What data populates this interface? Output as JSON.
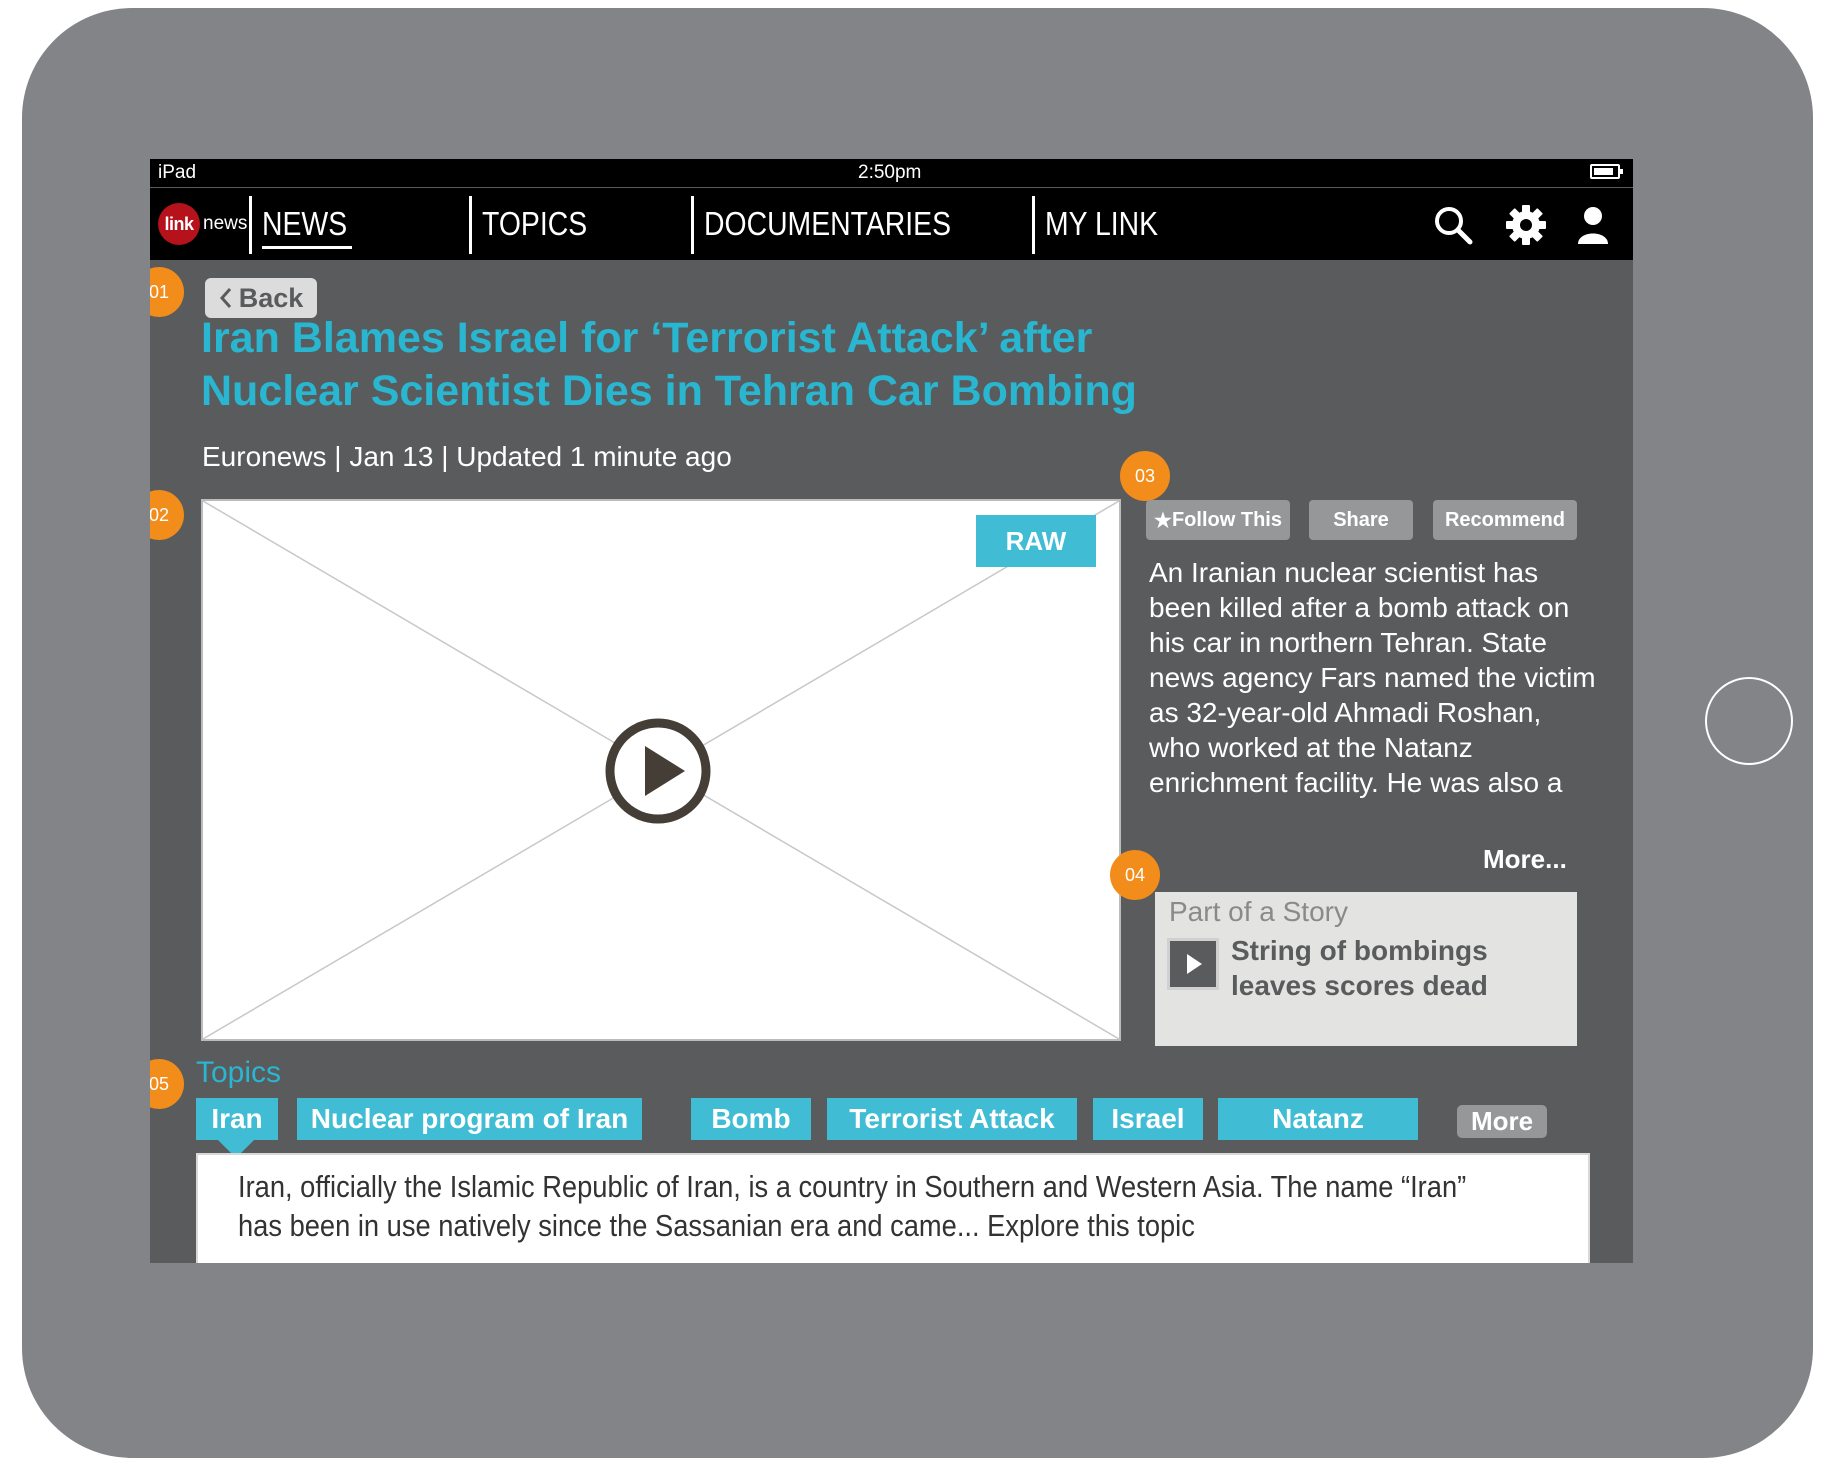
{
  "status_bar": {
    "device": "iPad",
    "time": "2:50pm"
  },
  "nav": {
    "logo_badge": "link",
    "logo_text": "news",
    "items": [
      {
        "label": "NEWS",
        "active": true
      },
      {
        "label": "TOPICS",
        "active": false
      },
      {
        "label": "DOCUMENTARIES",
        "active": false
      },
      {
        "label": "MY LINK",
        "active": false
      }
    ],
    "icons": [
      "search-icon",
      "gear-icon",
      "user-icon"
    ]
  },
  "article": {
    "back_label": "Back",
    "headline": "Iran Blames Israel for ‘Terrorist Attack’ after Nuclear Scientist Dies in Tehran Car Bombing",
    "byline": "Euronews | Jan 13  |  Updated 1 minute ago",
    "video_badge": "RAW",
    "actions": {
      "follow": "Follow This",
      "share": "Share",
      "recommend": "Recommend"
    },
    "summary": "An Iranian nuclear scientist has been killed after a bomb attack on his car in northern Tehran. State news agency Fars named the victim as 32-year-old Ahmadi Roshan, who worked at the Natanz enrichment facility. He was also a professor at Tehran’s",
    "more_label": "More..."
  },
  "story": {
    "label": "Part of a Story",
    "title": "String of bombings leaves scores dead"
  },
  "topics": {
    "label": "Topics",
    "tags": [
      "Iran",
      "Nuclear program of Iran",
      "Bomb",
      "Terrorist Attack",
      "Israel",
      "Natanz"
    ],
    "more_label": "More",
    "description": "Iran, officially the Islamic Republic of Iran, is a country in Southern and Western Asia. The name “Iran” has been in use natively since the Sassanian era and came... Explore this topic"
  },
  "annotations": [
    "01",
    "02",
    "03",
    "04",
    "05"
  ],
  "colors": {
    "accent": "#29b6d1",
    "tag": "#40bcd5",
    "marker": "#f28c1b",
    "logo": "#b5121b"
  }
}
